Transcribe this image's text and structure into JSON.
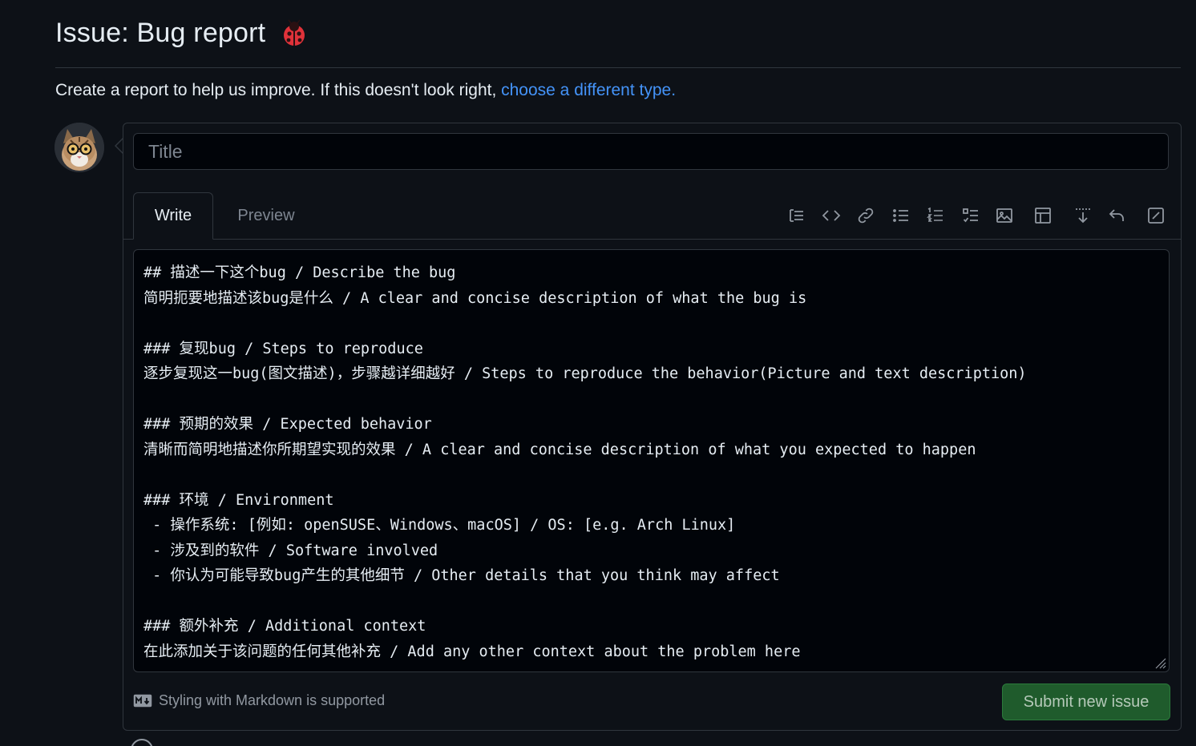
{
  "header": {
    "title": "Issue: Bug report",
    "emoji_icon": "ladybug-icon",
    "subtitle_text": "Create a report to help us improve. If this doesn't look right, ",
    "subtitle_link": "choose a different type."
  },
  "form": {
    "title_placeholder": "Title",
    "tabs": [
      {
        "label": "Write",
        "active": true
      },
      {
        "label": "Preview",
        "active": false
      }
    ],
    "toolbar_icons": [
      "heading-icon",
      "code-icon",
      "link-icon",
      "unordered-list-icon",
      "ordered-list-icon",
      "task-list-icon",
      "image-icon",
      "table-icon",
      "insert-below-icon",
      "undo-icon",
      "edit-mode-icon"
    ],
    "body_lines": [
      "## 描述一下这个bug / Describe the bug",
      "简明扼要地描述该bug是什么 / A clear and concise description of what the bug is",
      "",
      "### 复现bug / Steps to reproduce",
      "逐步复现这一bug(图文描述)，步骤越详细越好 / Steps to reproduce the behavior(Picture and text description)",
      "",
      "### 预期的效果 / Expected behavior",
      "清晰而简明地描述你所期望实现的效果 / A clear and concise description of what you expected to happen",
      "",
      "### 环境 / Environment",
      " - 操作系统: [例如: openSUSE、Windows、macOS] / OS: [e.g. Arch Linux]",
      " - 涉及到的软件 / Software involved",
      " - 你认为可能导致bug产生的其他细节 / Other details that you think may affect",
      "",
      "### 额外补充 / Additional context",
      "在此添加关于该问题的任何其他补充 / Add any other context about the problem here"
    ],
    "markdown_hint": "Styling with Markdown is supported",
    "submit_label": "Submit new issue"
  },
  "colors": {
    "background": "#0d1117",
    "link": "#4493f8",
    "submit": "#1f5b2c"
  }
}
